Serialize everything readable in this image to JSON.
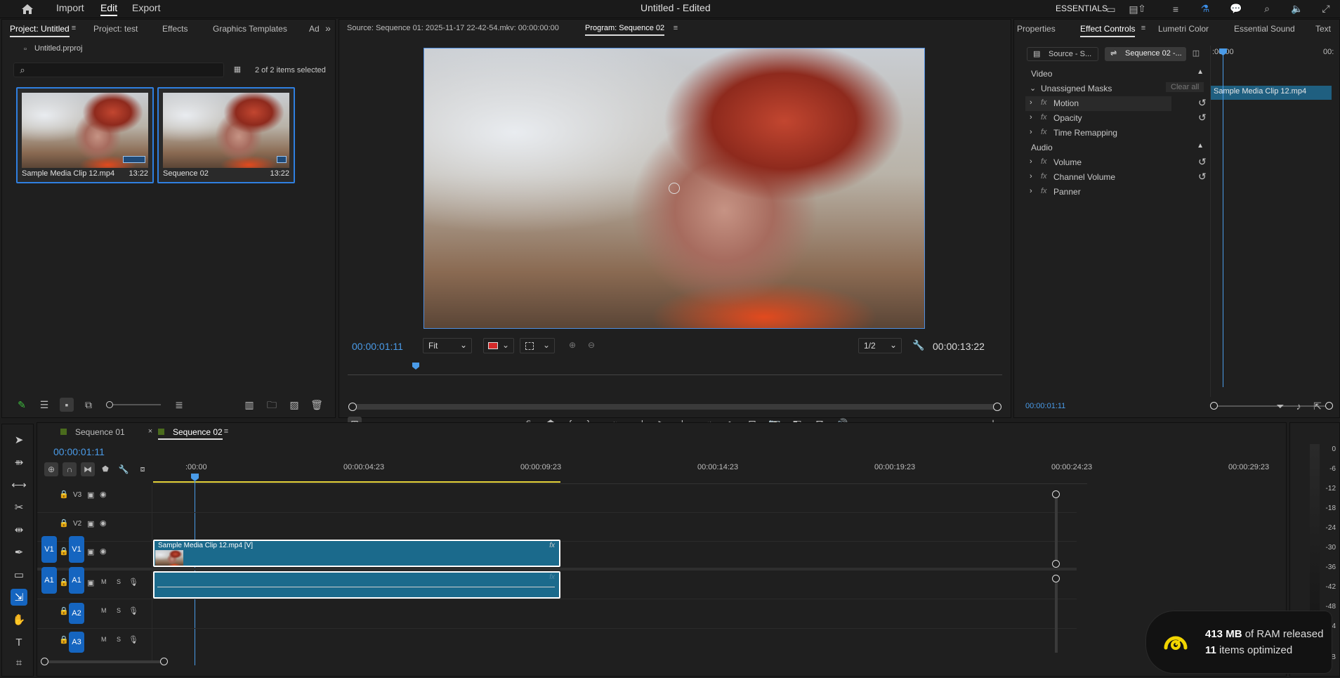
{
  "menu": {
    "import": "Import",
    "edit": "Edit",
    "export": "Export"
  },
  "window_title": "Untitled - Edited",
  "workspace": "ESSENTIALS",
  "project_panel": {
    "tabs": [
      "Project: Untitled",
      "Project: test",
      "Effects",
      "Graphics Templates",
      "Ad"
    ],
    "file": "Untitled.prproj",
    "search_placeholder": "",
    "selection_status": "2 of 2 items selected",
    "items": [
      {
        "name": "Sample Media Clip 12.mp4",
        "duration": "13:22"
      },
      {
        "name": "Sequence 02",
        "duration": "13:22"
      }
    ]
  },
  "monitor": {
    "source_tab": "Source: Sequence 01: 2025-11-17 22-42-54.mkv: 00:00:00:00",
    "program_tab": "Program: Sequence 02",
    "current_time": "00:00:01:11",
    "fit": "Fit",
    "resolution": "1/2",
    "duration": "00:00:13:22"
  },
  "effect_controls": {
    "tabs": [
      "Properties",
      "Effect Controls",
      "Lumetri Color",
      "Essential Sound",
      "Text"
    ],
    "source_chip": "Source - S...",
    "sequence_chip": "Sequence 02 -...",
    "video_header": "Video",
    "unassigned_masks": "Unassigned Masks",
    "clear_all": "Clear all",
    "video_effects": [
      "Motion",
      "Opacity",
      "Time Remapping"
    ],
    "audio_header": "Audio",
    "audio_effects": [
      "Volume",
      "Channel Volume",
      "Panner"
    ],
    "mini_ruler_start": ":00:00",
    "mini_ruler_end": "00:",
    "mini_clip": "Sample Media Clip 12.mp4",
    "time": "00:00:01:11"
  },
  "timeline": {
    "tabs": [
      "Sequence 01",
      "Sequence 02"
    ],
    "current_time": "00:00:01:11",
    "ruler": [
      ":00:00",
      "00:00:04:23",
      "00:00:09:23",
      "00:00:14:23",
      "00:00:19:23",
      "00:00:24:23",
      "00:00:29:23"
    ],
    "video_tracks": [
      "V3",
      "V2",
      "V1"
    ],
    "audio_tracks": [
      "A1",
      "A2",
      "A3"
    ],
    "source_patch_v": "V1",
    "source_patch_a": "A1",
    "track_m": "M",
    "track_s": "S",
    "clip_label": "Sample Media Clip 12.mp4 [V]",
    "fx": "fx"
  },
  "meter": {
    "labels": [
      "0",
      "-6",
      "-12",
      "-18",
      "-24",
      "-30",
      "-36",
      "-42",
      "-48",
      "-54",
      "dB"
    ]
  },
  "toast": {
    "amount": "413 MB",
    "amount_suffix": "of RAM released",
    "count": "11",
    "count_suffix": "items optimized"
  },
  "colors": {
    "accent": "#2f7fe0",
    "clip": "#1b6a8c",
    "timecode": "#4a9be8",
    "track_button": "#1565c0",
    "toast_icon": "#f2d500"
  }
}
